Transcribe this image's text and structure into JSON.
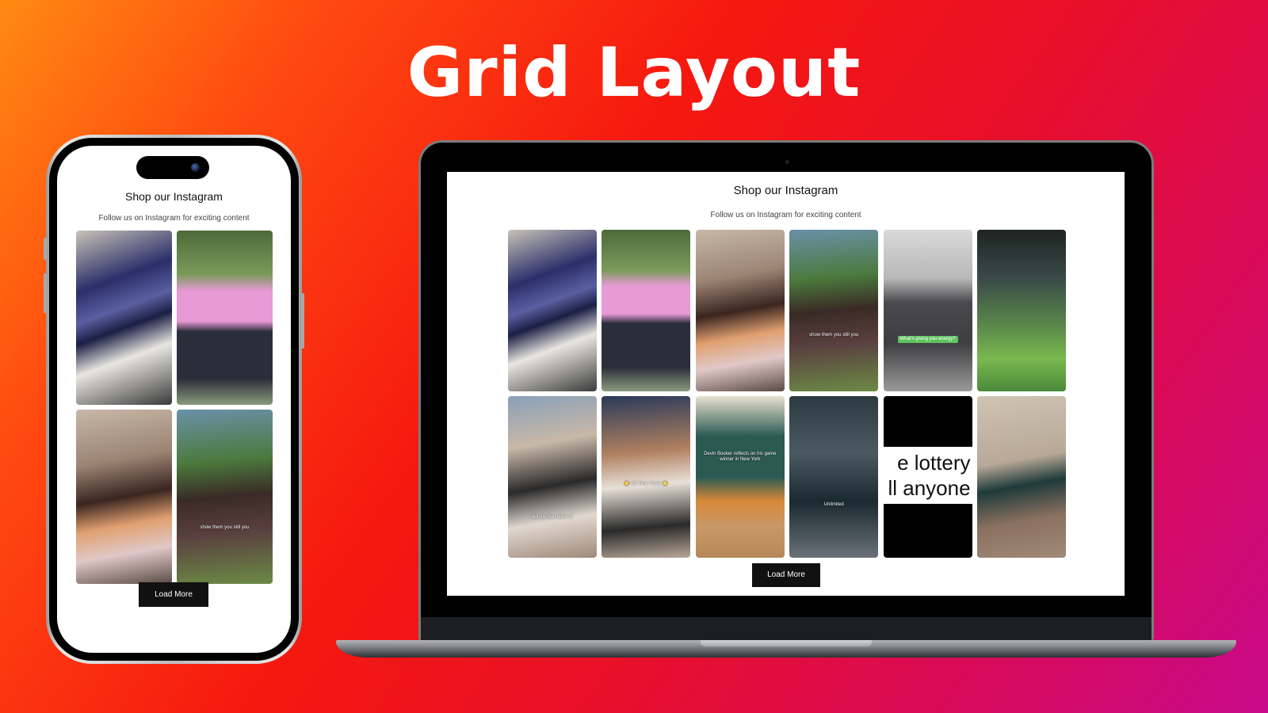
{
  "headline": "Grid Layout",
  "mobile": {
    "title": "Shop our Instagram",
    "subtitle": "Follow us on Instagram for exciting content",
    "load_more": "Load More",
    "posts": [
      {
        "name": "sneaker-collage",
        "caption": ""
      },
      {
        "name": "pink-tee-garden",
        "caption": ""
      },
      {
        "name": "locker-sneakers",
        "caption": ""
      },
      {
        "name": "garden-laughing",
        "caption": "show them you still you"
      }
    ]
  },
  "desktop": {
    "title": "Shop our Instagram",
    "subtitle": "Follow us on Instagram for exciting content",
    "load_more": "Load More",
    "posts": [
      {
        "name": "sneaker-collage",
        "caption": ""
      },
      {
        "name": "pink-tee-garden",
        "caption": ""
      },
      {
        "name": "locker-sneakers",
        "caption": ""
      },
      {
        "name": "garden-laughing",
        "caption": "show them you still you"
      },
      {
        "name": "grey-jacket",
        "caption": "What's giving you energy?"
      },
      {
        "name": "turf-field",
        "caption": ""
      },
      {
        "name": "arena-interview",
        "caption": "tell me the name of"
      },
      {
        "name": "all-star-trivia",
        "caption": "⭐ Air Time Trivia ⭐"
      },
      {
        "name": "devin-booker",
        "caption": "Devin Booker reflects on his game winner in New York"
      },
      {
        "name": "stage-unlimited",
        "caption": "Unlimited"
      },
      {
        "name": "lottery-text",
        "caption": "e lottery\nll anyone"
      },
      {
        "name": "studio-pose",
        "caption": ""
      }
    ]
  }
}
